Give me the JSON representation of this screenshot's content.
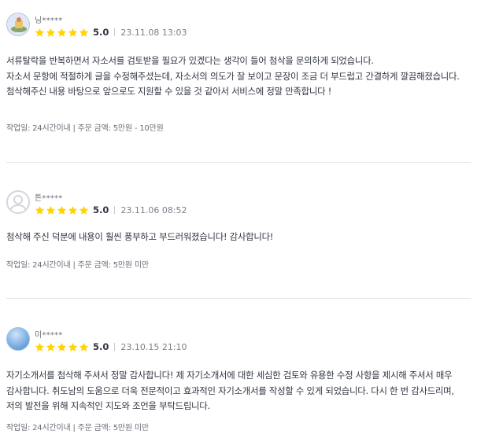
{
  "reviews": [
    {
      "nickname": "닝*****",
      "score": "5.0",
      "date": "23.11.08 13:03",
      "stars": 5,
      "avatar_icon": "illustration-avatar-icon",
      "body_lines": [
        "서류탈락을 반복하면서 자소서를 검토받을 필요가 있겠다는 생각이 들어 첨삭을 문의하게 되었습니다.",
        "자소서 문항에 적절하게 글을 수정해주셨는데, 자소서의 의도가 잘 보이고 문장이 조금 더 부드럽고 간결하게 깔끔해졌습니다.",
        "첨삭해주신 내용 바탕으로 앞으로도 지원할 수 있을 것 같아서 서비스에 정말 만족합니다 !"
      ],
      "meta": "작업일: 24시간이내 | 주문 금액: 5만원 - 10만원"
    },
    {
      "nickname": "튼*****",
      "score": "5.0",
      "date": "23.11.06 08:52",
      "stars": 5,
      "avatar_icon": "default-user-avatar-icon",
      "body_lines": [
        "첨삭해 주신 덕분에 내용이 훨씬 풍부하고 부드러워졌습니다! 감사합니다!"
      ],
      "meta": "작업일: 24시간이내 | 주문 금액: 5만원 미만"
    },
    {
      "nickname": "미*****",
      "score": "5.0",
      "date": "23.10.15 21:10",
      "stars": 5,
      "avatar_icon": "sky-avatar-icon",
      "body_lines": [
        "자기소개서를 첨삭해 주셔서 정말 감사합니다! 제 자기소개서에 대한 세심한 검토와 유용한 수정 사항을 제시해 주셔서 매우 감사합니다. 취도남의 도움으로 더욱 전문적이고 효과적인 자기소개서를 작성할 수 있게 되었습니다. 다시 한 번 감사드리며, 저의 발전을 위해 지속적인 지도와 조언을 부탁드립니다."
      ],
      "meta": "작업일: 24시간이내 | 주문 금액: 5만원 미만"
    }
  ],
  "colors": {
    "star": "#ffd400",
    "text": "#303441",
    "muted": "#7c818b",
    "divider": "#e6e7e9"
  }
}
